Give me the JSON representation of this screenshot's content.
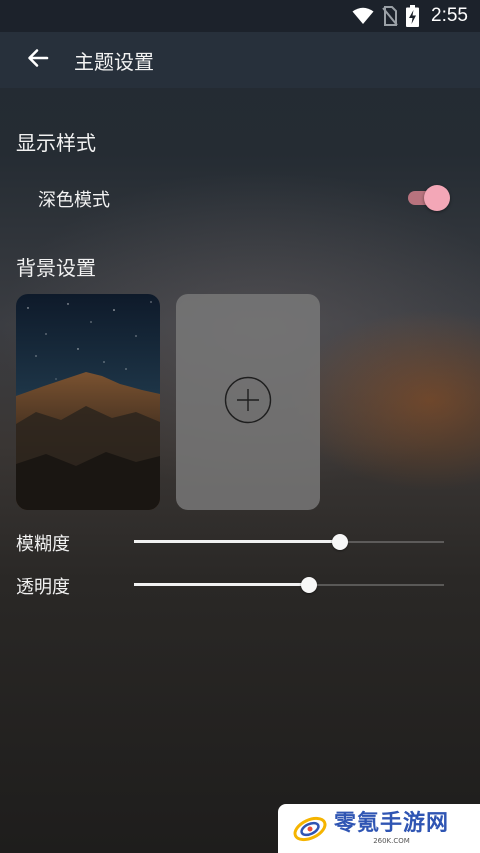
{
  "status_bar": {
    "time": "2:55",
    "icons": [
      "wifi-icon",
      "no-sim-icon",
      "battery-charging-icon"
    ]
  },
  "app_bar": {
    "back_icon": "arrow-left-icon",
    "title": "主题设置"
  },
  "display_section": {
    "title": "显示样式",
    "dark_mode": {
      "label": "深色模式",
      "enabled": true
    }
  },
  "background_section": {
    "title": "背景设置",
    "thumbnails": [
      {
        "name": "mountain-night-wallpaper"
      }
    ],
    "add_icon": "add-circle-icon"
  },
  "sliders": {
    "blur": {
      "label": "模糊度",
      "value": 0.665
    },
    "opacity": {
      "label": "透明度",
      "value": 0.565
    }
  },
  "watermark": {
    "text": "零氪手游网",
    "subtext": "260K.COM"
  },
  "colors": {
    "accent": "#f3a7b7",
    "app_bar": "#27303b",
    "status_bar": "#1c222b",
    "watermark_text": "#2f55b3"
  }
}
